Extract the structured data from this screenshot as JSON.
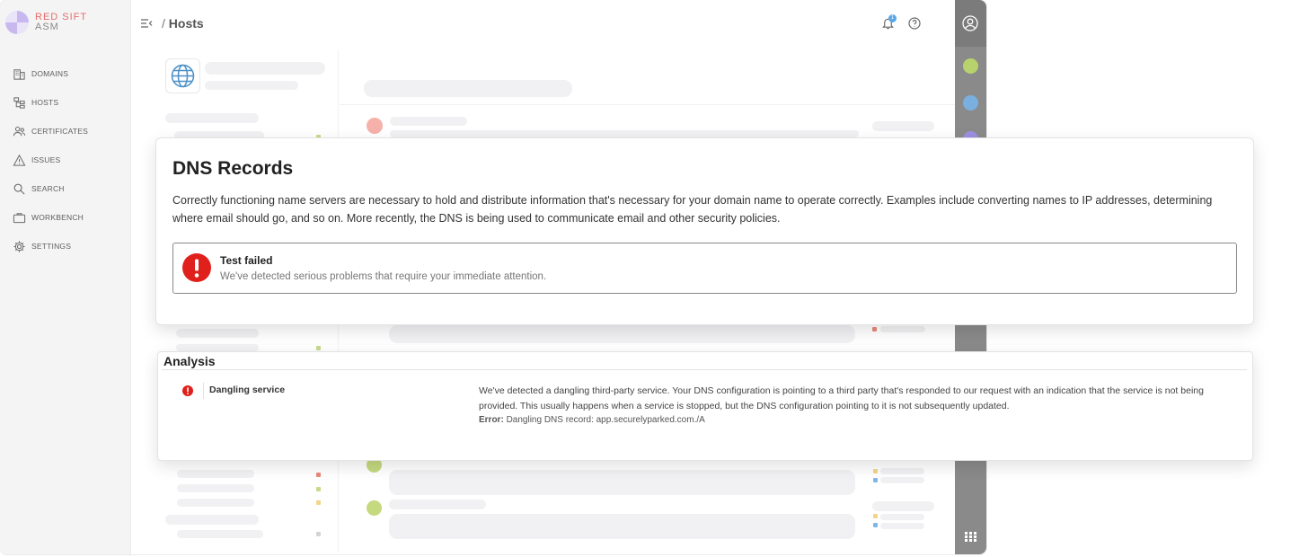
{
  "brand": {
    "line1": "RED SIFT",
    "line2": "ASM",
    "accent_color": "#e46c6c"
  },
  "sidebar": {
    "items": [
      {
        "label": "DOMAINS",
        "icon": "building-icon"
      },
      {
        "label": "HOSTS",
        "icon": "hierarchy-icon"
      },
      {
        "label": "CERTIFICATES",
        "icon": "users-icon"
      },
      {
        "label": "ISSUES",
        "icon": "warning-icon"
      },
      {
        "label": "SEARCH",
        "icon": "search-icon"
      },
      {
        "label": "WORKBENCH",
        "icon": "briefcase-icon"
      },
      {
        "label": "SETTINGS",
        "icon": "gear-icon"
      }
    ]
  },
  "header": {
    "breadcrumb_sep": "/",
    "title": "Hosts",
    "notification_count": "1"
  },
  "dns_card": {
    "title": "DNS Records",
    "description": "Correctly functioning name servers are necessary to hold and distribute information that's necessary for your domain name to operate correctly. Examples include converting names to IP addresses, determining where email should go, and so on. More recently, the DNS is being used to communicate email and other security policies.",
    "alert": {
      "title": "Test failed",
      "message": "We've detected serious problems that require your immediate attention.",
      "color": "#e0201b"
    }
  },
  "analysis": {
    "title": "Analysis",
    "items": [
      {
        "name": "Dangling service",
        "description": "We've detected a dangling third-party service. Your DNS configuration is pointing to a third party that's responded to our request with an indication that the service is not being provided. This usually happens when a service is stopped, but the DNS configuration pointing to it is not subsequently updated.",
        "error_label": "Error:",
        "error_value": "Dangling DNS record: app.securelyparked.com./A"
      }
    ]
  }
}
